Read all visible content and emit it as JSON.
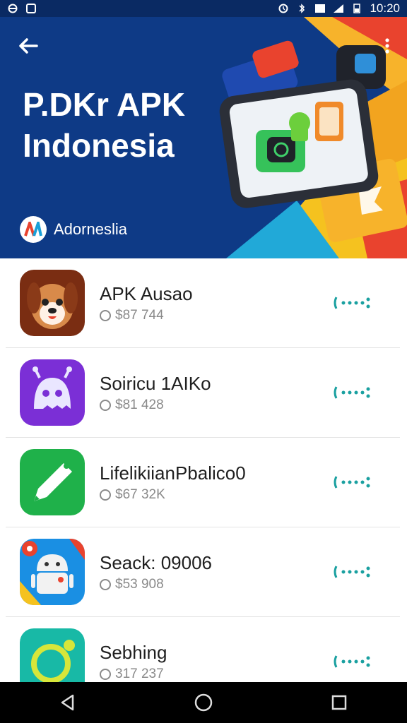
{
  "status_bar": {
    "time": "10:20"
  },
  "header": {
    "title": "P.DKr APK Indonesia",
    "brand_name": "Adornesliа",
    "brand_logo_text": "A4",
    "back_icon": "arrow-left-icon",
    "more_icon": "more-vert-icon"
  },
  "apps": [
    {
      "name": "APK Ausao",
      "meta": "$87 744",
      "icon": "dog-face-icon",
      "colors": [
        "#7a2d12",
        "#f0a05a"
      ]
    },
    {
      "name": "Soiricu 1AIKo",
      "meta": "$81 428",
      "icon": "ghost-robot-icon",
      "colors": [
        "#7b2fd6",
        "#a65cf0"
      ]
    },
    {
      "name": "LifelikiianPbalico0",
      "meta": "$67 32K",
      "icon": "pen-icon",
      "colors": [
        "#1fb14a",
        "#27c95a"
      ]
    },
    {
      "name": "Seack: 09006",
      "meta": "$53 908",
      "icon": "android-robot-icon",
      "colors": [
        "#1a8fe3",
        "#3bb0f5"
      ]
    },
    {
      "name": "Sebhing",
      "meta": "317 237",
      "icon": "ring-icon",
      "colors": [
        "#18b9a6",
        "#2fd0b8"
      ]
    }
  ],
  "nav": {
    "back_icon": "nav-back-icon",
    "home_icon": "nav-home-icon",
    "recents_icon": "nav-recents-icon"
  },
  "colors": {
    "header_bg": "#0e3a86",
    "accent": "#1aa0a0"
  }
}
